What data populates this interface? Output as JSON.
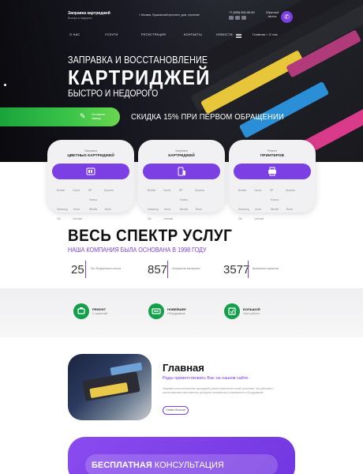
{
  "header": {
    "logo_title": "Заправка картриджей",
    "logo_sub": "Быстро и недорого",
    "address": "Москва, Пушкинский проспект, дом, строение",
    "phone": "+7 (000) 000-00-00",
    "callback": "Обратный звонок"
  },
  "nav": [
    "О НАС",
    "УСЛУГИ",
    "РЕГИСТРАЦИЯ",
    "КОНТАКТЫ",
    "НОВОСТИ",
    "Главная / О нас"
  ],
  "hero": {
    "line1": "ЗАПРАВКА И ВОССТАНОВЛЕНИЕ",
    "line2": "КАРТРИДЖЕЙ",
    "line3": "БЫСТРО И НЕДОРОГО",
    "button_label": "Оставить заявку",
    "promo": "СКИДКА 15% ПРИ ПЕРВОМ ОБРАЩЕНИИ"
  },
  "cards": [
    {
      "cap": "Заправка",
      "title": "ЦВЕТНЫХ КАРТРИДЖЕЙ",
      "icon": "color-cartridge-icon",
      "brands": [
        "Brother",
        "Canon",
        "HP",
        "Kyocera",
        "Samsung",
        "Xerox",
        "Konica-Minolta",
        "Ricoh",
        "Oki",
        "Lexmark"
      ]
    },
    {
      "cap": "Заправка",
      "title": "КАРТРИДЖЕЙ",
      "icon": "cartridge-icon",
      "brands": [
        "Brother",
        "Canon",
        "HP",
        "Kyocera",
        "Samsung",
        "Xerox",
        "Konica-Minolta",
        "Ricoh",
        "Oki",
        "Lexmark"
      ]
    },
    {
      "cap": "Ремонт",
      "title": "ПРИНТЕРОВ",
      "icon": "printer-icon",
      "brands": [
        "Brother",
        "Canon",
        "HP",
        "Kyocera",
        "Samsung",
        "Xerox",
        "Konica-Minolta",
        "Ricoh",
        "Oki",
        "Lexmark"
      ]
    }
  ],
  "services": {
    "title": "ВЕСЬ СПЕКТР УСЛУГ",
    "subtitle": "НАША КОМПАНИЯ БЫЛА ОСНОВАНА В 1998 ГОДУ",
    "stats": [
      {
        "num": "25",
        "desc": "Лет безупречного опыта"
      },
      {
        "num": "857",
        "desc": "Контрактов заключено"
      },
      {
        "num": "3577",
        "desc": "Выполнено проектов"
      }
    ]
  },
  "features": [
    {
      "title": "РЕМОНТ",
      "sub": "С гарантией"
    },
    {
      "title": "НОВЕЙШЕЕ",
      "sub": "Оборудование"
    },
    {
      "title": "БОЛЬШОЙ",
      "sub": "Опыт работы"
    }
  ],
  "about": {
    "title": "Главная",
    "subtitle": "Рады приветствовать Вас на нашем сайте.",
    "text": "Заправка и восстановление картриджей, ремонт принтеров и иной оргтехники. Мы работаем с использованием качественных расходных материалов и современного оборудования.",
    "button": "Узнать больше"
  },
  "consult": {
    "bold": "БЕСПЛАТНАЯ",
    "rest": " КОНСУЛЬТАЦИЯ"
  },
  "colors": {
    "accent": "#7b3fe4",
    "green": "#14a04a"
  }
}
